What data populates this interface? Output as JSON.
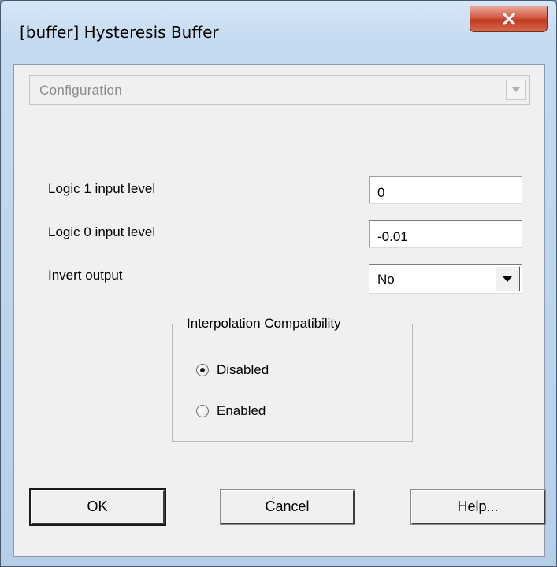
{
  "window": {
    "title": "[buffer] Hysteresis Buffer",
    "close_icon": "close-icon"
  },
  "configuration": {
    "value": "Configuration",
    "disabled": true
  },
  "fields": {
    "logic1": {
      "label": "Logic 1 input level",
      "value": "0"
    },
    "logic0": {
      "label": "Logic 0 input level",
      "value": "-0.01"
    },
    "invert": {
      "label": "Invert output",
      "value": "No"
    }
  },
  "interpolation": {
    "title": "Interpolation Compatibility",
    "options": [
      {
        "label": "Disabled",
        "checked": true
      },
      {
        "label": "Enabled",
        "checked": false
      }
    ]
  },
  "buttons": {
    "ok": "OK",
    "cancel": "Cancel",
    "help": "Help..."
  }
}
